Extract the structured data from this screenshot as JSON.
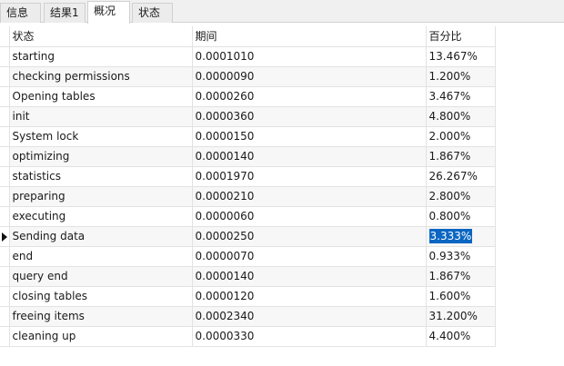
{
  "tabs": [
    {
      "label": "信息",
      "active": false
    },
    {
      "label": "结果1",
      "active": false
    },
    {
      "label": "概况",
      "active": true
    },
    {
      "label": "状态",
      "active": false
    }
  ],
  "table": {
    "columns": [
      "状态",
      "期间",
      "百分比"
    ],
    "selected_row": 9,
    "rows": [
      {
        "status": "starting",
        "duration": "0.0001010",
        "percent": "13.467%"
      },
      {
        "status": "checking permissions",
        "duration": "0.0000090",
        "percent": "1.200%"
      },
      {
        "status": "Opening tables",
        "duration": "0.0000260",
        "percent": "3.467%"
      },
      {
        "status": "init",
        "duration": "0.0000360",
        "percent": "4.800%"
      },
      {
        "status": "System lock",
        "duration": "0.0000150",
        "percent": "2.000%"
      },
      {
        "status": "optimizing",
        "duration": "0.0000140",
        "percent": "1.867%"
      },
      {
        "status": "statistics",
        "duration": "0.0001970",
        "percent": "26.267%"
      },
      {
        "status": "preparing",
        "duration": "0.0000210",
        "percent": "2.800%"
      },
      {
        "status": "executing",
        "duration": "0.0000060",
        "percent": "0.800%"
      },
      {
        "status": "Sending data",
        "duration": "0.0000250",
        "percent": "3.333%"
      },
      {
        "status": "end",
        "duration": "0.0000070",
        "percent": "0.933%"
      },
      {
        "status": "query end",
        "duration": "0.0000140",
        "percent": "1.867%"
      },
      {
        "status": "closing tables",
        "duration": "0.0000120",
        "percent": "1.600%"
      },
      {
        "status": "freeing items",
        "duration": "0.0002340",
        "percent": "31.200%"
      },
      {
        "status": "cleaning up",
        "duration": "0.0000330",
        "percent": "4.400%"
      }
    ]
  },
  "colors": {
    "selection": "#0a66c2",
    "tab_bar": "#f0f0f0",
    "alt_row": "#f7f7f7"
  }
}
